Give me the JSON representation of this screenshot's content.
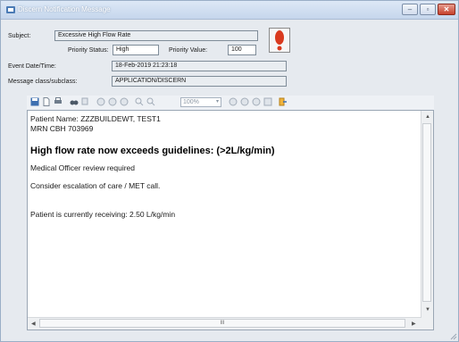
{
  "window": {
    "title": "Discern Notification Message",
    "minimize_label": "–",
    "maximize_label": "▫",
    "close_label": "✕"
  },
  "header": {
    "subject_label": "Subject:",
    "subject_value": "Excessive High Flow Rate",
    "priority_status_label": "Priority Status:",
    "priority_status_value": "High",
    "priority_value_label": "Priority Value:",
    "priority_value_value": "100",
    "event_label": "Event Date/Time:",
    "event_value": "18-Feb-2019 21:23:18",
    "class_label": "Message class/subclass:",
    "class_value": "APPLICATION/DISCERN"
  },
  "toolbar": {
    "zoom_value": "100%"
  },
  "document": {
    "patient_line": "Patient Name: ZZZBUILDEWT, TEST1",
    "mrn_line": "MRN CBH 703969",
    "heading": "High flow rate now exceeds guidelines: (>2L/kg/min)",
    "line1": "Medical Officer review required",
    "line2": "Consider escalation of care / MET call.",
    "line3": "Patient is currently receiving: 2.50 L/kg/min"
  },
  "scrollbar": {
    "hthumb_label": "III"
  },
  "colors": {
    "alert": "#d93a1e",
    "titlebar": "#c5d6ec"
  }
}
